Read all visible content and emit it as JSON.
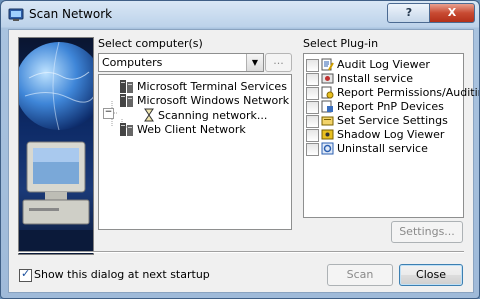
{
  "window": {
    "title": "Scan Network",
    "help_label": "?",
    "close_glyph": "X"
  },
  "computers": {
    "label": "Select computer(s)",
    "combo_value": "Computers",
    "browse_label": "...",
    "tree": [
      {
        "label": "Microsoft Terminal Services",
        "icon": "network-server-icon"
      },
      {
        "label": "Microsoft Windows Network",
        "icon": "network-server-icon",
        "expanded": true
      },
      {
        "label": "Scanning network...",
        "icon": "hourglass-icon"
      },
      {
        "label": "Web Client Network",
        "icon": "network-server-icon"
      }
    ]
  },
  "plugins": {
    "label": "Select Plug-in",
    "items": [
      {
        "label": "Audit Log Viewer",
        "icon": "log-viewer-icon"
      },
      {
        "label": "Install service",
        "icon": "install-service-icon"
      },
      {
        "label": "Report Permissions/Auditing",
        "icon": "report-permissions-icon"
      },
      {
        "label": "Report PnP Devices",
        "icon": "pnp-devices-icon"
      },
      {
        "label": "Set Service Settings",
        "icon": "service-settings-icon"
      },
      {
        "label": "Shadow Log Viewer",
        "icon": "shadow-log-icon"
      },
      {
        "label": "Uninstall service",
        "icon": "uninstall-service-icon"
      }
    ],
    "settings_label": "Settings..."
  },
  "footer": {
    "startup_label": "Show this dialog at next startup",
    "startup_checked": true,
    "scan_label": "Scan",
    "close_label": "Close"
  }
}
